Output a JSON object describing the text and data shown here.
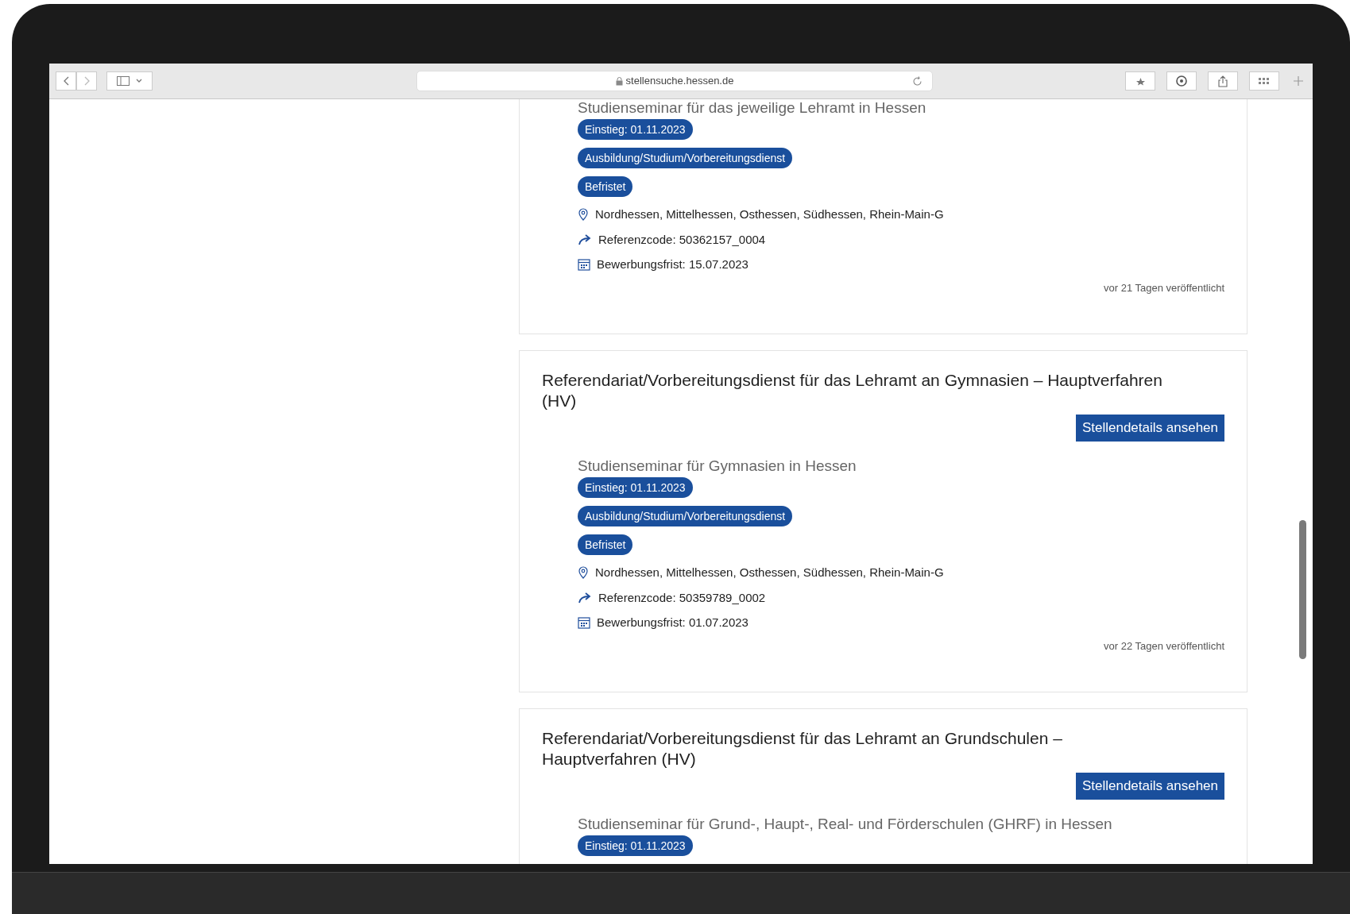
{
  "browser": {
    "url": "stellensuche.hessen.de"
  },
  "cards": [
    {
      "seminar": "Studienseminar für das jeweilige Lehramt in Hessen",
      "tags": [
        "Einstieg: 01.11.2023",
        "Ausbildung/Studium/Vorbereitungsdienst",
        "Befristet"
      ],
      "location": "Nordhessen, Mittelhessen, Osthessen, Südhessen, Rhein-Main-G",
      "reference": "Referenzcode: 50362157_0004",
      "deadline": "Bewerbungsfrist: 15.07.2023",
      "published": "vor 21 Tagen veröffentlicht"
    },
    {
      "title": "Referendariat/Vorbereitungsdienst für das Lehramt an Gymnasien – Hauptverfahren (HV)",
      "button": "Stellendetails ansehen",
      "seminar": "Studienseminar für Gymnasien in Hessen",
      "tags": [
        "Einstieg: 01.11.2023",
        "Ausbildung/Studium/Vorbereitungsdienst",
        "Befristet"
      ],
      "location": "Nordhessen, Mittelhessen, Osthessen, Südhessen, Rhein-Main-G",
      "reference": "Referenzcode: 50359789_0002",
      "deadline": "Bewerbungsfrist: 01.07.2023",
      "published": "vor 22 Tagen veröffentlicht"
    },
    {
      "title": "Referendariat/Vorbereitungsdienst für das Lehramt an Grundschulen – Hauptverfahren (HV)",
      "button": "Stellendetails ansehen",
      "seminar": "Studienseminar für Grund-, Haupt-, Real- und Förderschulen (GHRF) in Hessen",
      "tags": [
        "Einstieg: 01.11.2023"
      ]
    }
  ]
}
